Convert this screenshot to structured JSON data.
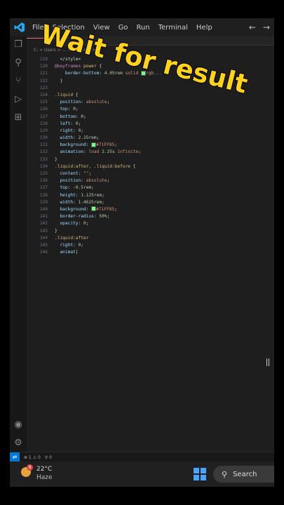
{
  "menu": {
    "items": [
      "File",
      "Selection",
      "View",
      "Go",
      "Run",
      "Terminal",
      "Help"
    ]
  },
  "breadcrumb": "C: > Users > ... > style.css > ...",
  "overlay": {
    "caption": "Wait for result"
  },
  "code_lines": [
    {
      "n": "119",
      "parts": [
        [
          "txt",
          "  </style>"
        ]
      ]
    },
    {
      "n": "120",
      "parts": [
        [
          "kw",
          "@keyframes"
        ],
        [
          "txt",
          " "
        ],
        [
          "sel",
          "power"
        ],
        [
          "txt",
          " {"
        ]
      ]
    },
    {
      "n": "121",
      "parts": [
        [
          "txt",
          "    "
        ],
        [
          "prop",
          "border-bottom"
        ],
        [
          "txt",
          ": "
        ],
        [
          "num",
          "4.05rem"
        ],
        [
          "txt",
          " "
        ],
        [
          "val",
          "solid"
        ],
        [
          "txt",
          " "
        ],
        [
          "swatch",
          ""
        ],
        [
          "val",
          "rgb..."
        ]
      ]
    },
    {
      "n": "122",
      "parts": [
        [
          "txt",
          "  }"
        ]
      ]
    },
    {
      "n": "123",
      "parts": [
        [
          "txt",
          ""
        ]
      ]
    },
    {
      "n": "124",
      "parts": [
        [
          "sel",
          ".liquid"
        ],
        [
          "txt",
          " {"
        ]
      ]
    },
    {
      "n": "125",
      "parts": [
        [
          "txt",
          "  "
        ],
        [
          "prop",
          "position"
        ],
        [
          "txt",
          ": "
        ],
        [
          "val",
          "absolute"
        ],
        [
          "txt",
          ";"
        ]
      ]
    },
    {
      "n": "126",
      "parts": [
        [
          "txt",
          "  "
        ],
        [
          "prop",
          "top"
        ],
        [
          "txt",
          ": "
        ],
        [
          "num",
          "0"
        ],
        [
          "txt",
          ";"
        ]
      ]
    },
    {
      "n": "127",
      "parts": [
        [
          "txt",
          "  "
        ],
        [
          "prop",
          "bottom"
        ],
        [
          "txt",
          ": "
        ],
        [
          "num",
          "0"
        ],
        [
          "txt",
          ";"
        ]
      ]
    },
    {
      "n": "128",
      "parts": [
        [
          "txt",
          "  "
        ],
        [
          "prop",
          "left"
        ],
        [
          "txt",
          ": "
        ],
        [
          "num",
          "0"
        ],
        [
          "txt",
          ";"
        ]
      ]
    },
    {
      "n": "129",
      "parts": [
        [
          "txt",
          "  "
        ],
        [
          "prop",
          "right"
        ],
        [
          "txt",
          ": "
        ],
        [
          "num",
          "0"
        ],
        [
          "txt",
          ";"
        ]
      ]
    },
    {
      "n": "130",
      "parts": [
        [
          "txt",
          "  "
        ],
        [
          "prop",
          "width"
        ],
        [
          "txt",
          ": "
        ],
        [
          "num",
          "2.25rem"
        ],
        [
          "txt",
          ";"
        ]
      ]
    },
    {
      "n": "131",
      "parts": [
        [
          "txt",
          "  "
        ],
        [
          "prop",
          "background"
        ],
        [
          "txt",
          ": "
        ],
        [
          "swatch",
          ""
        ],
        [
          "val",
          "#71FF85"
        ],
        [
          "txt",
          ";"
        ]
      ]
    },
    {
      "n": "132",
      "parts": [
        [
          "txt",
          "  "
        ],
        [
          "prop",
          "animation"
        ],
        [
          "txt",
          ": "
        ],
        [
          "val",
          "load"
        ],
        [
          "txt",
          " "
        ],
        [
          "num",
          "2.25s"
        ],
        [
          "txt",
          " "
        ],
        [
          "val",
          "infinite"
        ],
        [
          "txt",
          ";"
        ]
      ]
    },
    {
      "n": "133",
      "parts": [
        [
          "txt",
          "}"
        ]
      ]
    },
    {
      "n": "134",
      "parts": [
        [
          "sel",
          ".liquid:after, .liquid:before"
        ],
        [
          "txt",
          " {"
        ]
      ]
    },
    {
      "n": "135",
      "parts": [
        [
          "txt",
          "  "
        ],
        [
          "prop",
          "content"
        ],
        [
          "txt",
          ": "
        ],
        [
          "val",
          "\"\""
        ],
        [
          "txt",
          ";"
        ]
      ]
    },
    {
      "n": "136",
      "parts": [
        [
          "txt",
          "  "
        ],
        [
          "prop",
          "position"
        ],
        [
          "txt",
          ": "
        ],
        [
          "val",
          "absolute"
        ],
        [
          "txt",
          ";"
        ]
      ]
    },
    {
      "n": "137",
      "parts": [
        [
          "txt",
          "  "
        ],
        [
          "prop",
          "top"
        ],
        [
          "txt",
          ": "
        ],
        [
          "num",
          "-0.5rem"
        ],
        [
          "txt",
          ";"
        ]
      ]
    },
    {
      "n": "138",
      "parts": [
        [
          "txt",
          "  "
        ],
        [
          "prop",
          "height"
        ],
        [
          "txt",
          ": "
        ],
        [
          "num",
          "1.125rem"
        ],
        [
          "txt",
          ";"
        ]
      ]
    },
    {
      "n": "139",
      "parts": [
        [
          "txt",
          "  "
        ],
        [
          "prop",
          "width"
        ],
        [
          "txt",
          ": "
        ],
        [
          "num",
          "1.4625rem"
        ],
        [
          "txt",
          ";"
        ]
      ]
    },
    {
      "n": "140",
      "parts": [
        [
          "txt",
          "  "
        ],
        [
          "prop",
          "background"
        ],
        [
          "txt",
          ": "
        ],
        [
          "swatch",
          ""
        ],
        [
          "val",
          "#71FF85"
        ],
        [
          "txt",
          ";"
        ]
      ]
    },
    {
      "n": "141",
      "parts": [
        [
          "txt",
          "  "
        ],
        [
          "prop",
          "border-radius"
        ],
        [
          "txt",
          ": "
        ],
        [
          "num",
          "50%"
        ],
        [
          "txt",
          ";"
        ]
      ]
    },
    {
      "n": "142",
      "parts": [
        [
          "txt",
          "  "
        ],
        [
          "prop",
          "opacity"
        ],
        [
          "txt",
          ": "
        ],
        [
          "num",
          "0"
        ],
        [
          "txt",
          ";"
        ]
      ]
    },
    {
      "n": "143",
      "parts": [
        [
          "txt",
          "}"
        ]
      ]
    },
    {
      "n": "144",
      "parts": [
        [
          "sel",
          ".liquid:after"
        ]
      ]
    },
    {
      "n": "145",
      "parts": [
        [
          "txt",
          "  "
        ],
        [
          "prop",
          "right"
        ],
        [
          "txt",
          ": "
        ],
        [
          "num",
          "0"
        ],
        [
          "txt",
          ";"
        ]
      ]
    },
    {
      "n": "146",
      "parts": [
        [
          "txt",
          "  "
        ],
        [
          "prop",
          "animat"
        ],
        [
          "txt",
          "|"
        ]
      ]
    }
  ],
  "status": {
    "problems": "⊗ 1 ⚠ 0",
    "ports": "⚲ 0"
  },
  "taskbar": {
    "weather_badge": "9",
    "temperature": "22°C",
    "condition": "Haze",
    "search_label": "Search"
  },
  "colors": {
    "caption": "#ffd21f",
    "swatch": "#71ff85",
    "accent": "#0078d4"
  },
  "icons": [
    "vscode-logo-icon",
    "explorer-icon",
    "search-icon",
    "source-control-icon",
    "run-debug-icon",
    "extensions-icon",
    "account-icon",
    "settings-gear-icon",
    "back-arrow-icon",
    "forward-arrow-icon",
    "windows-start-icon",
    "weather-icon",
    "text-cursor-icon"
  ]
}
